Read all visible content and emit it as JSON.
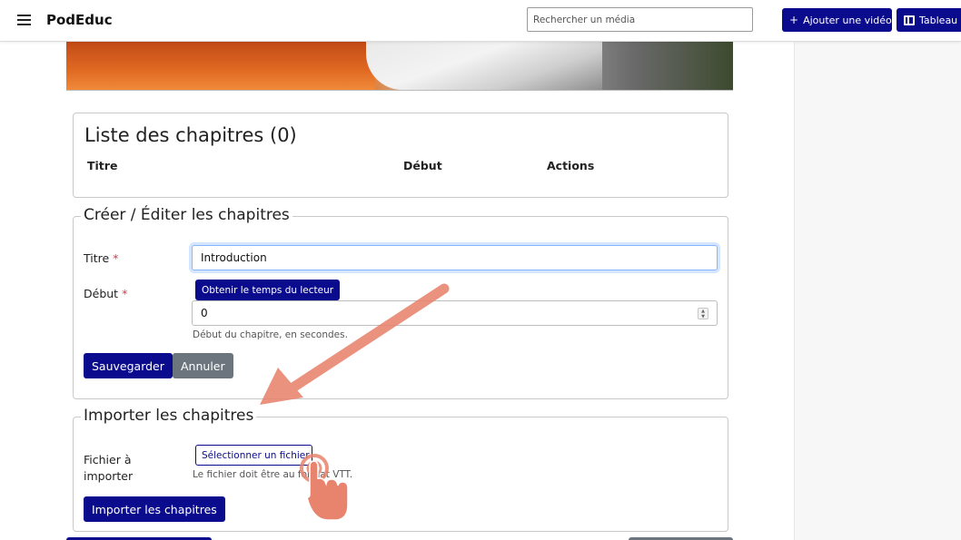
{
  "navbar": {
    "brand": "PodEduc",
    "search_placeholder": "Rechercher un média",
    "add_video_label": "Ajouter une vidéo",
    "dashboard_label": "Tableau"
  },
  "chapters_list": {
    "title": "Liste des chapitres (0)",
    "columns": [
      "Titre",
      "Début",
      "Actions"
    ]
  },
  "edit_form": {
    "legend": "Créer / Éditer les chapitres",
    "title_label": "Titre",
    "title_value": "Introduction",
    "start_label": "Début",
    "required_mark": "*",
    "get_time_button": "Obtenir le temps du lecteur",
    "start_value": "0",
    "start_help": "Début du chapitre, en secondes.",
    "save_button": "Sauvegarder",
    "cancel_button": "Annuler"
  },
  "import_form": {
    "legend": "Importer les chapitres",
    "file_label": "Fichier à importer",
    "select_file_button": "Sélectionner un fichier",
    "file_help": "Le fichier doit être au format VTT.",
    "import_button": "Importer les chapitres"
  },
  "colors": {
    "primary": "#0b0b8e",
    "secondary": "#6c757d",
    "required": "#dc3545",
    "annotation": "#e8836d"
  },
  "icons": [
    "hamburger-icon",
    "plus-icon",
    "film-icon",
    "arrow-annotation-icon",
    "pointer-hand-icon"
  ]
}
